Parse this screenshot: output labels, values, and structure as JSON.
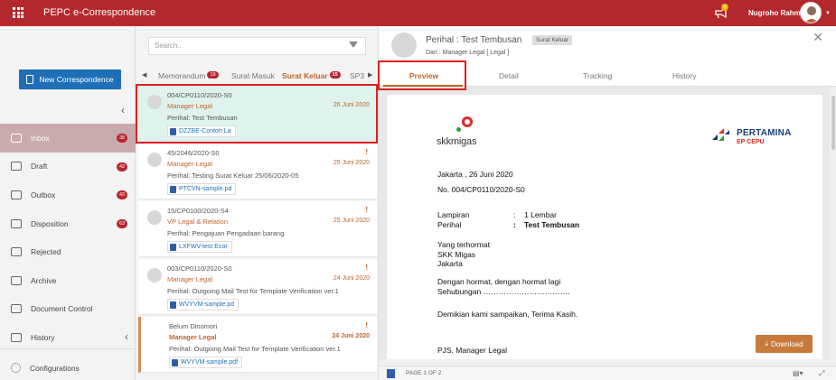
{
  "topbar": {
    "app_title": "PEPC e-Correspondence",
    "notification_count": "0",
    "user_name": "Nugroho Rahm"
  },
  "leftnav": {
    "new_button": "New Correspondence",
    "items": [
      {
        "label": "Inbox",
        "badge": "38",
        "active": true
      },
      {
        "label": "Draft",
        "badge": "42"
      },
      {
        "label": "Outbox",
        "badge": "43"
      },
      {
        "label": "Disposition",
        "badge": "63"
      },
      {
        "label": "Rejected",
        "badge": ""
      },
      {
        "label": "Archive",
        "badge": ""
      },
      {
        "label": "Document Control",
        "badge": ""
      },
      {
        "label": "History",
        "badge": ""
      }
    ],
    "configurations": "Configurations"
  },
  "list": {
    "search_placeholder": "Search..",
    "tabs": [
      {
        "label": "Memorandum",
        "badge": "19"
      },
      {
        "label": "Surat Masuk",
        "badge": ""
      },
      {
        "label": "Surat Keluar",
        "badge": "15"
      },
      {
        "label": "SP3",
        "badge": ""
      }
    ],
    "items": [
      {
        "number": "004/CP0110/2020-S0",
        "from": "Manager Legal",
        "date": "26 Juni 2020",
        "subject": "Perihal: Test Tembusan",
        "file": "DZZBE-Contoh La",
        "flag": ""
      },
      {
        "number": "45/2046/2020-S0",
        "from": "Manager Legal",
        "date": "25 Juni 2020",
        "subject": "Perihal: Testing Surat Keluar 25/06/2020-05",
        "file": "PTCVN-sample.pd",
        "flag": "!"
      },
      {
        "number": "15/CP0100/2020-S4",
        "from": "VP Legal & Relation",
        "date": "25 Juni 2020",
        "subject": "Perihal: Pengajuan Pengadaan barang",
        "file": "LXFWV-test Ecor",
        "flag": "!"
      },
      {
        "number": "003/CP0110/2020-S0",
        "from": "Manager Legal",
        "date": "24 Juni 2020",
        "subject": "Perihal: Outgoing Mail Test for Template Verification ver.1",
        "file": "WVYVM-sample.pd",
        "flag": "!"
      },
      {
        "number": "Belum Dinomori",
        "from": "Manager Legal",
        "date": "24 Juni 2020",
        "subject": "Perihal: Outgoing Mail Test for Template Verification ver.1",
        "file": "WVYVM-sample.pdf",
        "flag": "!"
      }
    ]
  },
  "detail": {
    "title": "Perihal : Test Tembusan",
    "tag": "Surat Keluar",
    "from": "Dari : Manager Legal [ Legal ]",
    "tabs": [
      "Preview",
      "Detail",
      "Tracking",
      "History"
    ],
    "letter": {
      "logo_left": "skkmigas",
      "logo_right_name": "PERTAMINA",
      "logo_right_unit": "EP CEPU",
      "place_date": "Jakarta , 26 Juni 2020",
      "number": "No. 004/CP0110/2020-S0",
      "lampiran_label": "Lampiran",
      "lampiran_sep": ":",
      "lampiran_value": "1 Lembar",
      "perihal_label": "Perihal",
      "perihal_sep": ":",
      "perihal_value": "Test Tembusan",
      "to_1": "Yang terhormat",
      "to_2": "SKK Migas",
      "to_3": "Jakarta",
      "body_1": "Dengan hormat, dengan hormat lagi",
      "body_2": "Sehubungan …………………………….",
      "closing": "Demikian kami sampaikan, Terima Kasih.",
      "signature": "PJS. Manager Legal"
    },
    "download_label": "Download",
    "page_indicator": "PAGE 1 OF 2"
  }
}
